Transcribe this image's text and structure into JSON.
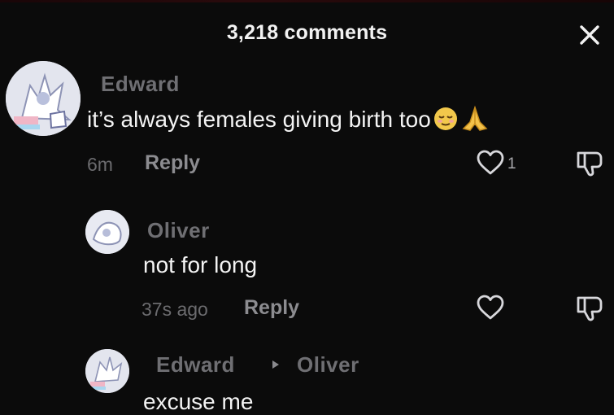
{
  "header": {
    "comment_count_label": "3,218 comments"
  },
  "comments": [
    {
      "username": "Edward",
      "text": "it’s always females giving birth too",
      "time": "6m",
      "reply_label": "Reply",
      "likes": "1"
    }
  ],
  "replies": [
    {
      "username": "Oliver",
      "text": "not for long",
      "time": "37s ago",
      "reply_label": "Reply"
    },
    {
      "username": "Edward",
      "reply_to": "Oliver",
      "text": "excuse me"
    }
  ],
  "colors": {
    "background": "#0b0b0b",
    "username": "#6f6f73",
    "text": "#f4f4f4",
    "meta": "#6b6b6e"
  }
}
